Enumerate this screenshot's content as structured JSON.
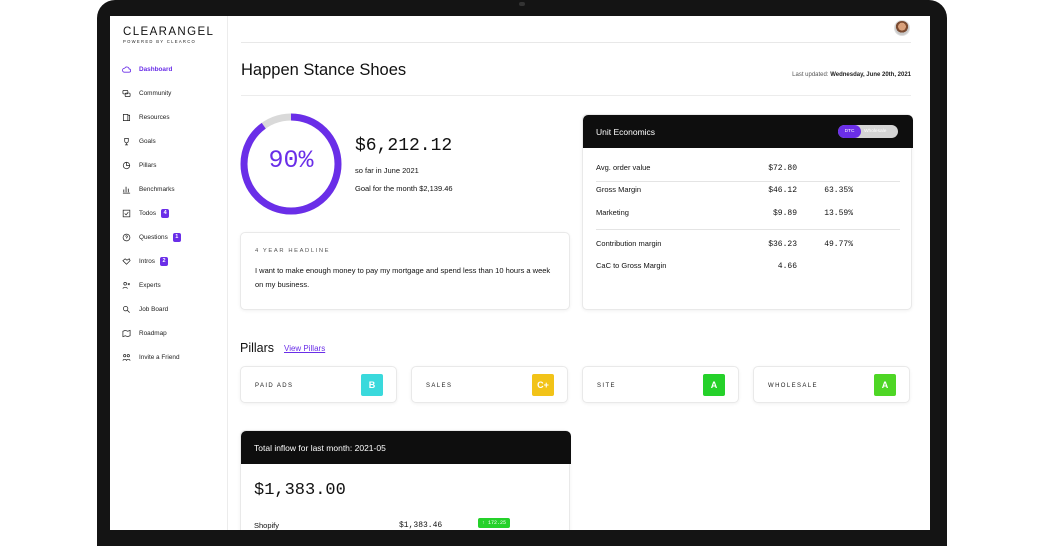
{
  "brand": {
    "name": "CLEARANGEL",
    "tagline": "POWERED BY CLEARCO"
  },
  "sidebar": {
    "items": [
      {
        "label": "Dashboard",
        "icon": "cloud-icon",
        "active": true,
        "badge": ""
      },
      {
        "label": "Community",
        "icon": "chat-icon",
        "active": false,
        "badge": ""
      },
      {
        "label": "Resources",
        "icon": "book-icon",
        "active": false,
        "badge": ""
      },
      {
        "label": "Goals",
        "icon": "trophy-icon",
        "active": false,
        "badge": ""
      },
      {
        "label": "Pillars",
        "icon": "pie-icon",
        "active": false,
        "badge": ""
      },
      {
        "label": "Benchmarks",
        "icon": "bars-icon",
        "active": false,
        "badge": ""
      },
      {
        "label": "Todos",
        "icon": "checkbox-icon",
        "active": false,
        "badge": "4"
      },
      {
        "label": "Questions",
        "icon": "question-icon",
        "active": false,
        "badge": "1"
      },
      {
        "label": "Intros",
        "icon": "handshake-icon",
        "active": false,
        "badge": "2"
      },
      {
        "label": "Experts",
        "icon": "expert-icon",
        "active": false,
        "badge": ""
      },
      {
        "label": "Job Board",
        "icon": "job-icon",
        "active": false,
        "badge": ""
      },
      {
        "label": "Roadmap",
        "icon": "map-icon",
        "active": false,
        "badge": ""
      },
      {
        "label": "Invite a Friend",
        "icon": "people-icon",
        "active": false,
        "badge": ""
      }
    ]
  },
  "header": {
    "title": "Happen Stance Shoes",
    "updated_prefix": "Last updated: ",
    "updated_date": "Wednesday, June 20th, 2021"
  },
  "progress": {
    "percent_label": "90%",
    "fraction": 0.9,
    "amount": "$6,212.12",
    "so_far": "so far in June 2021",
    "goal": "Goal for the month $2,139.46"
  },
  "headline": {
    "label": "4 YEAR HEADLINE",
    "text": "I want to make enough money to pay my mortgage and spend less than 10 hours a week on my business."
  },
  "unit_economics": {
    "title": "Unit Economics",
    "toggle_on": "DTC",
    "toggle_off": "Wholesale",
    "rows": [
      {
        "label": "Avg. order value",
        "value": "$72.80",
        "pct": ""
      },
      {
        "label": "Gross Margin",
        "value": "$46.12",
        "pct": "63.35%"
      },
      {
        "label": "Marketing",
        "value": "$9.89",
        "pct": "13.59%"
      },
      {
        "label": "Contribution margin",
        "value": "$36.23",
        "pct": "49.77%"
      },
      {
        "label": "CaC to Gross Margin",
        "value": "4.66",
        "pct": ""
      }
    ]
  },
  "pillars": {
    "title": "Pillars",
    "link": "View Pillars",
    "items": [
      {
        "label": "PAID ADS",
        "grade": "B",
        "color": "#3ad9dc"
      },
      {
        "label": "SALES",
        "grade": "C+",
        "color": "#f2c318"
      },
      {
        "label": "SITE",
        "grade": "A",
        "color": "#25d12a"
      },
      {
        "label": "WHOLESALE",
        "grade": "A",
        "color": "#4ed625"
      }
    ]
  },
  "inflow": {
    "title": "Total inflow for last month: 2021-05",
    "amount": "$1,383.00",
    "source": "Shopify",
    "source_value": "$1,383.46",
    "delta": "↑ 172.25"
  },
  "colors": {
    "accent": "#6a2ee8",
    "dark": "#0e0e0e"
  }
}
